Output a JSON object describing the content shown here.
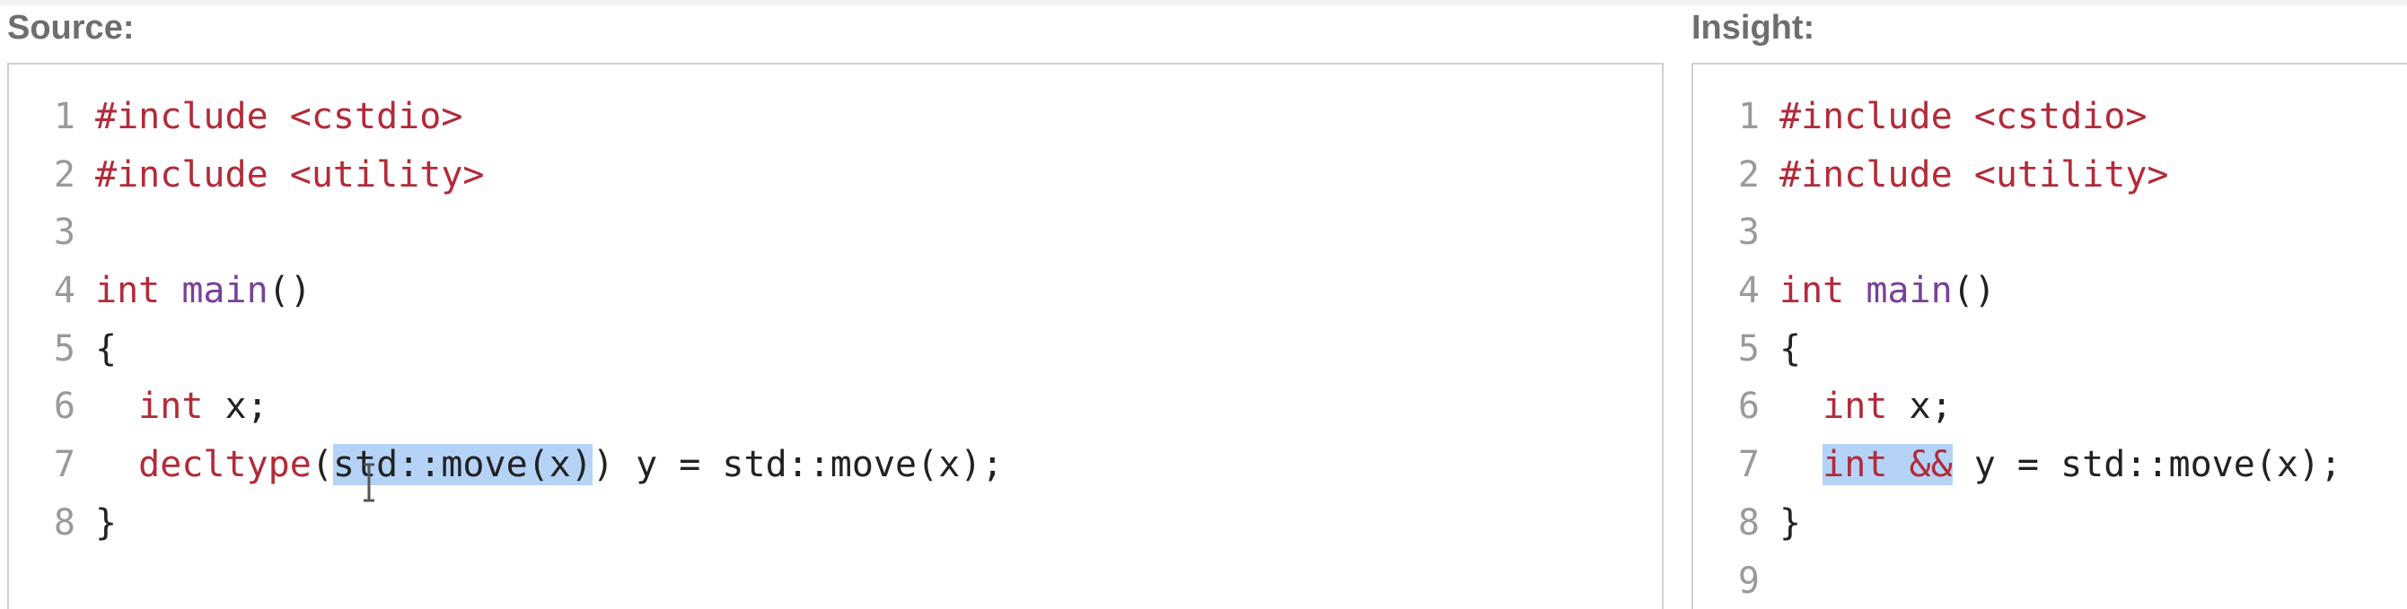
{
  "source_label": "Source:",
  "insight_label": "Insight:",
  "source": {
    "lines": [
      {
        "num": "1",
        "tokens": [
          {
            "t": "#include <cstdio>",
            "c": "pre"
          }
        ]
      },
      {
        "num": "2",
        "tokens": [
          {
            "t": "#include <utility>",
            "c": "pre"
          }
        ]
      },
      {
        "num": "3",
        "tokens": []
      },
      {
        "num": "4",
        "tokens": [
          {
            "t": "int",
            "c": "ty"
          },
          {
            "t": " ",
            "c": ""
          },
          {
            "t": "main",
            "c": "fn"
          },
          {
            "t": "()",
            "c": ""
          }
        ]
      },
      {
        "num": "5",
        "tokens": [
          {
            "t": "{",
            "c": ""
          }
        ]
      },
      {
        "num": "6",
        "tokens": [
          {
            "t": "  ",
            "c": ""
          },
          {
            "t": "int",
            "c": "ty"
          },
          {
            "t": " x;",
            "c": ""
          }
        ]
      },
      {
        "num": "7",
        "tokens": [
          {
            "t": "  ",
            "c": ""
          },
          {
            "t": "decltype",
            "c": "kw"
          },
          {
            "t": "(",
            "c": ""
          },
          {
            "t": "std::move(x)",
            "c": "",
            "sel": true
          },
          {
            "t": ") y = std::move(x);",
            "c": ""
          }
        ]
      },
      {
        "num": "8",
        "tokens": [
          {
            "t": "}",
            "c": ""
          }
        ]
      }
    ]
  },
  "insight": {
    "lines": [
      {
        "num": "1",
        "tokens": [
          {
            "t": "#include <cstdio>",
            "c": "pre"
          }
        ]
      },
      {
        "num": "2",
        "tokens": [
          {
            "t": "#include <utility>",
            "c": "pre"
          }
        ]
      },
      {
        "num": "3",
        "tokens": []
      },
      {
        "num": "4",
        "tokens": [
          {
            "t": "int",
            "c": "ty"
          },
          {
            "t": " ",
            "c": ""
          },
          {
            "t": "main",
            "c": "fn"
          },
          {
            "t": "()",
            "c": ""
          }
        ]
      },
      {
        "num": "5",
        "tokens": [
          {
            "t": "{",
            "c": ""
          }
        ]
      },
      {
        "num": "6",
        "tokens": [
          {
            "t": "  ",
            "c": ""
          },
          {
            "t": "int",
            "c": "ty"
          },
          {
            "t": " x;",
            "c": ""
          }
        ]
      },
      {
        "num": "7",
        "tokens": [
          {
            "t": "  ",
            "c": ""
          },
          {
            "t": "int &&",
            "c": "ty",
            "sel": true
          },
          {
            "t": " y = std::move(x);",
            "c": ""
          }
        ]
      },
      {
        "num": "8",
        "tokens": [
          {
            "t": "}",
            "c": ""
          }
        ]
      },
      {
        "num": "9",
        "tokens": []
      }
    ]
  },
  "colors": {
    "preprocessor": "#b22b39",
    "keyword": "#b22b39",
    "function": "#7a3f9c",
    "selection": "#b4d3f7",
    "line_number": "#9a9a9a"
  },
  "icons": {
    "cursor": "text-cursor-icon"
  }
}
